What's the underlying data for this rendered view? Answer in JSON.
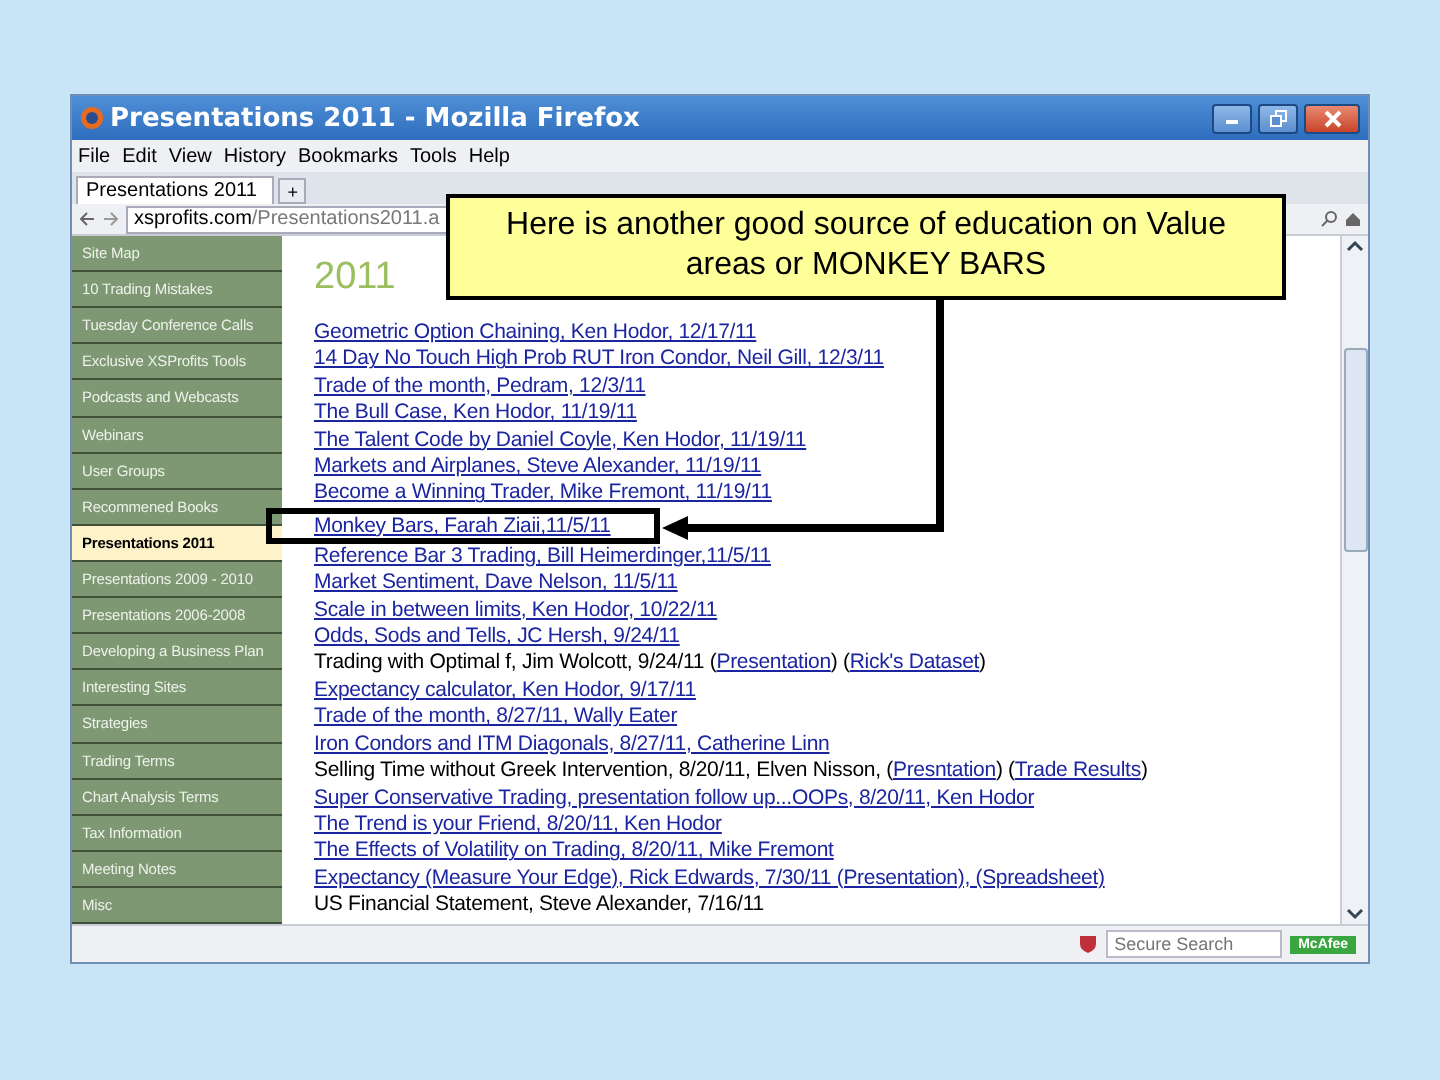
{
  "window": {
    "title": "Presentations 2011 - Mozilla Firefox"
  },
  "menu": [
    "File",
    "Edit",
    "View",
    "History",
    "Bookmarks",
    "Tools",
    "Help"
  ],
  "tabs": [
    {
      "label": "Presentations 2011",
      "selected": true
    }
  ],
  "new_tab": "+",
  "address_bar": {
    "domain": "xsprofits.com",
    "path": "/Presentations2011.a"
  },
  "sidebar": {
    "items": [
      {
        "label": "Site Map",
        "selected": false
      },
      {
        "label": "10 Trading Mistakes",
        "selected": false
      },
      {
        "label": "Tuesday Conference Calls",
        "selected": false
      },
      {
        "label": "Exclusive XSProfits Tools",
        "selected": false
      },
      {
        "label": "Podcasts and Webcasts",
        "selected": false
      },
      {
        "label": "Webinars",
        "selected": false
      },
      {
        "label": "User Groups",
        "selected": false
      },
      {
        "label": "Recommened Books",
        "selected": false
      },
      {
        "label": "Presentations 2011",
        "selected": true
      },
      {
        "label": "Presentations 2009 - 2010",
        "selected": false
      },
      {
        "label": "Presentations 2006-2008",
        "selected": false
      },
      {
        "label": "Developing a Business Plan",
        "selected": false
      },
      {
        "label": "Interesting Sites",
        "selected": false
      },
      {
        "label": "Strategies",
        "selected": false
      },
      {
        "label": "Trading Terms",
        "selected": false
      },
      {
        "label": "Chart Analysis Terms",
        "selected": false
      },
      {
        "label": "Tax Information",
        "selected": false
      },
      {
        "label": "Meeting Notes",
        "selected": false
      },
      {
        "label": "Misc",
        "selected": false
      }
    ]
  },
  "content": {
    "heading": "2011",
    "entries": [
      {
        "parts": [
          {
            "text": "Geometric Option Chaining, Ken Hodor, 12/17/11",
            "kind": "link"
          }
        ]
      },
      {
        "parts": [
          {
            "text": "14 Day No Touch High Prob RUT Iron Condor, Neil Gill, 12/3/11",
            "kind": "link"
          }
        ]
      },
      {
        "parts": [
          {
            "text": "Trade of the month, Pedram, 12/3/11",
            "kind": "link"
          }
        ]
      },
      {
        "parts": [
          {
            "text": "The Bull Case, Ken Hodor, 11/19/11",
            "kind": "link"
          }
        ]
      },
      {
        "parts": [
          {
            "text": "The Talent Code by Daniel Coyle, Ken Hodor, 11/19/11",
            "kind": "link"
          }
        ]
      },
      {
        "parts": [
          {
            "text": "Markets and Airplanes, Steve Alexander, 11/19/11",
            "kind": "link"
          }
        ]
      },
      {
        "parts": [
          {
            "text": "Become a Winning Trader, Mike Fremont, 11/19/11",
            "kind": "link"
          }
        ]
      },
      {
        "parts": [
          {
            "text": "Monkey Bars, Farah Ziaii,11/5/11",
            "kind": "link"
          }
        ],
        "highlighted": true
      },
      {
        "parts": [
          {
            "text": "Reference Bar 3 Trading, Bill Heimerdinger,11/5/11",
            "kind": "link"
          }
        ]
      },
      {
        "parts": [
          {
            "text": "Market Sentiment, Dave Nelson, 11/5/11",
            "kind": "link"
          }
        ]
      },
      {
        "parts": [
          {
            "text": "Scale in between limits, Ken Hodor, 10/22/11",
            "kind": "link"
          }
        ]
      },
      {
        "parts": [
          {
            "text": "Odds, Sods and Tells, JC Hersh, 9/24/11",
            "kind": "link"
          }
        ]
      },
      {
        "parts": [
          {
            "text": "Trading with Optimal f, Jim Wolcott, 9/24/11 (",
            "kind": "plain"
          },
          {
            "text": "Presentation",
            "kind": "link"
          },
          {
            "text": ") (",
            "kind": "plain"
          },
          {
            "text": "Rick's Dataset",
            "kind": "link"
          },
          {
            "text": ")",
            "kind": "plain"
          }
        ]
      },
      {
        "parts": [
          {
            "text": "Expectancy calculator, Ken Hodor, 9/17/11",
            "kind": "link"
          }
        ]
      },
      {
        "parts": [
          {
            "text": "Trade of the month, 8/27/11, Wally Eater",
            "kind": "link"
          }
        ]
      },
      {
        "parts": [
          {
            "text": "Iron Condors and ITM Diagonals, 8/27/11, Catherine Linn",
            "kind": "link"
          }
        ]
      },
      {
        "parts": [
          {
            "text": "Selling Time without Greek Intervention, 8/20/11, Elven Nisson, (",
            "kind": "plain"
          },
          {
            "text": "Presntation",
            "kind": "link"
          },
          {
            "text": ") (",
            "kind": "plain"
          },
          {
            "text": "Trade Results",
            "kind": "link"
          },
          {
            "text": ")",
            "kind": "plain"
          }
        ]
      },
      {
        "parts": [
          {
            "text": "Super Conservative Trading, presentation follow up...OOPs, 8/20/11, Ken Hodor",
            "kind": "link"
          }
        ]
      },
      {
        "parts": [
          {
            "text": "The Trend is your Friend, 8/20/11, Ken Hodor",
            "kind": "link"
          }
        ]
      },
      {
        "parts": [
          {
            "text": "The Effects of Volatility on Trading, 8/20/11, Mike Fremont",
            "kind": "link"
          }
        ]
      },
      {
        "parts": [
          {
            "text": "Expectancy (Measure Your Edge), Rick Edwards, 7/30/11 (Presentation), (Spreadsheet)",
            "kind": "link"
          }
        ]
      },
      {
        "parts": [
          {
            "text": "US Financial Statement, Steve Alexander, 7/16/11",
            "kind": "plain"
          }
        ]
      }
    ]
  },
  "status_bar": {
    "search_placeholder": "Secure Search",
    "badge": "McAfee"
  },
  "callout": {
    "text": "Here is another good source of education on Value areas or MONKEY BARS"
  }
}
